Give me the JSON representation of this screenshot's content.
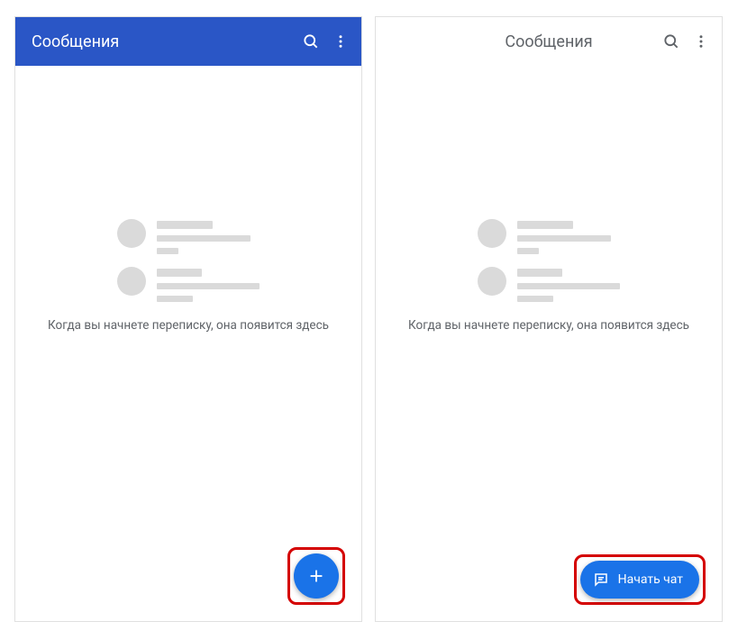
{
  "left": {
    "title": "Сообщения",
    "empty_text": "Когда вы начнете переписку, она появится здесь"
  },
  "right": {
    "title": "Сообщения",
    "empty_text": "Когда вы начнете переписку, она появится здесь",
    "fab_label": "Начать чат"
  }
}
